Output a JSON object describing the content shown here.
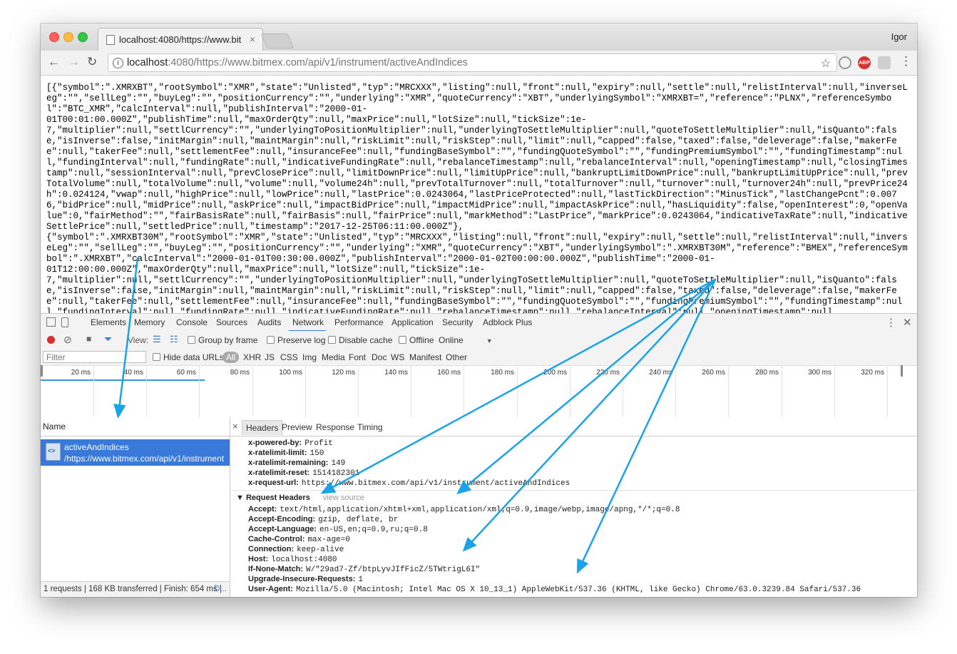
{
  "browser": {
    "tab_title": "localhost:4080/https://www.bit",
    "tab_close": "×",
    "user_name": "Igor",
    "url_host": "localhost",
    "url_rest": ":4080/https://www.bitmex.com/api/v1/instrument/activeAndIndices",
    "back": "←",
    "forward": "→",
    "reload": "↻",
    "star": "☆",
    "menu": "⋮",
    "abp": "ABP"
  },
  "page": {
    "json_text": "[{\"symbol\":\".XMRXBT\",\"rootSymbol\":\"XMR\",\"state\":\"Unlisted\",\"typ\":\"MRCXXX\",\"listing\":null,\"front\":null,\"expiry\":null,\"settle\":null,\"relistInterval\":null,\"inverseLeg\":\"\",\"sellLeg\":\"\",\"buyLeg\":\"\",\"positionCurrency\":\"\",\"underlying\":\"XMR\",\"quoteCurrency\":\"XBT\",\"underlyingSymbol\":\"XMRXBT=\",\"reference\":\"PLNX\",\"referenceSymbol\":\"BTC_XMR\",\"calcInterval\":null,\"publishInterval\":\"2000-01-\n01T00:01:00.000Z\",\"publishTime\":null,\"maxOrderQty\":null,\"maxPrice\":null,\"lotSize\":null,\"tickSize\":1e-\n7,\"multiplier\":null,\"settlCurrency\":\"\",\"underlyingToPositionMultiplier\":null,\"underlyingToSettleMultiplier\":null,\"quoteToSettleMultiplier\":null,\"isQuanto\":false,\"isInverse\":false,\"initMargin\":null,\"maintMargin\":null,\"riskLimit\":null,\"riskStep\":null,\"limit\":null,\"capped\":false,\"taxed\":false,\"deleverage\":false,\"makerFee\":null,\"takerFee\":null,\"settlementFee\":null,\"insuranceFee\":null,\"fundingBaseSymbol\":\"\",\"fundingQuoteSymbol\":\"\",\"fundingPremiumSymbol\":\"\",\"fundingTimestamp\":null,\"fundingInterval\":null,\"fundingRate\":null,\"indicativeFundingRate\":null,\"rebalanceTimestamp\":null,\"rebalanceInterval\":null,\"openingTimestamp\":null,\"closingTimestamp\":null,\"sessionInterval\":null,\"prevClosePrice\":null,\"limitDownPrice\":null,\"limitUpPrice\":null,\"bankruptLimitDownPrice\":null,\"bankruptLimitUpPrice\":null,\"prevTotalVolume\":null,\"totalVolume\":null,\"volume\":null,\"volume24h\":null,\"prevTotalTurnover\":null,\"totalTurnover\":null,\"turnover\":null,\"turnover24h\":null,\"prevPrice24h\":0.024124,\"vwap\":null,\"highPrice\":null,\"lowPrice\":null,\"lastPrice\":0.0243064,\"lastPriceProtected\":null,\"lastTickDirection\":\"MinusTick\",\"lastChangePcnt\":0.0076,\"bidPrice\":null,\"midPrice\":null,\"askPrice\":null,\"impactBidPrice\":null,\"impactMidPrice\":null,\"impactAskPrice\":null,\"hasLiquidity\":false,\"openInterest\":0,\"openValue\":0,\"fairMethod\":\"\",\"fairBasisRate\":null,\"fairBasis\":null,\"fairPrice\":null,\"markMethod\":\"LastPrice\",\"markPrice\":0.0243064,\"indicativeTaxRate\":null,\"indicativeSettlePrice\":null,\"settledPrice\":null,\"timestamp\":\"2017-12-25T06:11:00.000Z\"},\n{\"symbol\":\".XMRXBT30M\",\"rootSymbol\":\"XMR\",\"state\":\"Unlisted\",\"typ\":\"MRCXXX\",\"listing\":null,\"front\":null,\"expiry\":null,\"settle\":null,\"relistInterval\":null,\"inverseLeg\":\"\",\"sellLeg\":\"\",\"buyLeg\":\"\",\"positionCurrency\":\"\",\"underlying\":\"XMR\",\"quoteCurrency\":\"XBT\",\"underlyingSymbol\":\".XMRXBT30M\",\"reference\":\"BMEX\",\"referenceSymbol\":\".XMRXBT\",\"calcInterval\":\"2000-01-01T00:30:00.000Z\",\"publishInterval\":\"2000-01-02T00:00:00.000Z\",\"publishTime\":\"2000-01-\n01T12:00:00.000Z\",\"maxOrderQty\":null,\"maxPrice\":null,\"lotSize\":null,\"tickSize\":1e-\n7,\"multiplier\":null,\"settlCurrency\":\"\",\"underlyingToPositionMultiplier\":null,\"underlyingToSettleMultiplier\":null,\"quoteToSettleMultiplier\":null,\"isQuanto\":false,\"isInverse\":false,\"initMargin\":null,\"maintMargin\":null,\"riskLimit\":null,\"riskStep\":null,\"limit\":null,\"capped\":false,\"taxed\":false,\"deleverage\":false,\"makerFee\":null,\"takerFee\":null,\"settlementFee\":null,\"insuranceFee\":null,\"fundingBaseSymbol\":\"\",\"fundingQuoteSymbol\":\"\",\"fundingPremiumSymbol\":\"\",\"fundingTimestamp\":null,\"fundingInterval\":null,\"fundingRate\":null,\"indicativeFundingRate\":null,\"rebalanceTimestamp\":null,\"rebalanceInterval\":null,\"openingTimestamp\":null"
  },
  "devtools": {
    "tabs": [
      "Elements",
      "Memory",
      "Console",
      "Sources",
      "Audits",
      "Network",
      "Performance",
      "Application",
      "Security",
      "Adblock Plus"
    ],
    "active_tab": "Network",
    "view_label": "View:",
    "group_by_frame": "Group by frame",
    "preserve_log": "Preserve log",
    "disable_cache": "Disable cache",
    "offline": "Offline",
    "throttle": "Online",
    "filter_placeholder": "Filter",
    "hide_data_urls": "Hide data URLs",
    "filter_types": [
      "All",
      "XHR",
      "JS",
      "CSS",
      "Img",
      "Media",
      "Font",
      "Doc",
      "WS",
      "Manifest",
      "Other"
    ],
    "timeline_ticks": [
      "20 ms",
      "40 ms",
      "60 ms",
      "80 ms",
      "100 ms",
      "120 ms",
      "140 ms",
      "160 ms",
      "180 ms",
      "200 ms",
      "220 ms",
      "240 ms",
      "260 ms",
      "280 ms",
      "300 ms",
      "320 ms"
    ],
    "name_header": "Name",
    "request_name": "activeAndIndices",
    "request_path": "/https://www.bitmex.com/api/v1/instrument",
    "status_bar": "1 requests | 168 KB transferred | Finish: 654 ms |",
    "status_more": "D...",
    "detail_tabs": [
      "Headers",
      "Preview",
      "Response",
      "Timing"
    ],
    "detail_close": "×",
    "response_headers": [
      {
        "name": "x-powered-by:",
        "value": "Profit"
      },
      {
        "name": "x-ratelimit-limit:",
        "value": "150"
      },
      {
        "name": "x-ratelimit-remaining:",
        "value": "149"
      },
      {
        "name": "x-ratelimit-reset:",
        "value": "1514182301"
      },
      {
        "name": "x-request-url:",
        "value": "https://www.bitmex.com/api/v1/instrument/activeAndIndices"
      }
    ],
    "request_headers_title": "▼ Request Headers",
    "view_source": "view source",
    "request_headers": [
      {
        "name": "Accept:",
        "value": "text/html,application/xhtml+xml,application/xml;q=0.9,image/webp,image/apng,*/*;q=0.8"
      },
      {
        "name": "Accept-Encoding:",
        "value": "gzip, deflate, br"
      },
      {
        "name": "Accept-Language:",
        "value": "en-US,en;q=0.9,ru;q=0.8"
      },
      {
        "name": "Cache-Control:",
        "value": "max-age=0"
      },
      {
        "name": "Connection:",
        "value": "keep-alive"
      },
      {
        "name": "Host:",
        "value": "localhost:4080"
      },
      {
        "name": "If-None-Match:",
        "value": "W/\"29ad7-Zf/btpLyvJIfFicZ/5TWtrigL6I\""
      },
      {
        "name": "Upgrade-Insecure-Requests:",
        "value": "1"
      },
      {
        "name": "User-Agent:",
        "value": "Mozilla/5.0 (Macintosh; Intel Mac OS X 10_13_1) AppleWebKit/537.36 (KHTML, like Gecko) Chrome/63.0.3239.84 Safari/537.36"
      }
    ]
  },
  "colors": {
    "annotation_arrow": "#1aa3e8",
    "selection": "#3879d9"
  }
}
